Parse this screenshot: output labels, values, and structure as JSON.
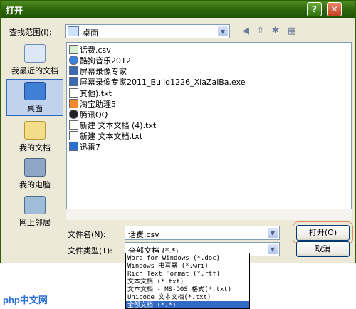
{
  "window": {
    "title": "打开",
    "help_glyph": "?",
    "close_glyph": "✕"
  },
  "lookin": {
    "label": "查找范围(I):",
    "value": "桌面"
  },
  "places": [
    {
      "label": "我最近的文档"
    },
    {
      "label": "桌面"
    },
    {
      "label": "我的文档"
    },
    {
      "label": "我的电脑"
    },
    {
      "label": "网上邻居"
    }
  ],
  "files": [
    "话费.csv",
    "酷狗音乐2012",
    "屏幕录像专家",
    "屏幕录像专家2011_Build1226_XiaZaiBa.exe",
    "其他).txt",
    "淘宝助理5",
    "腾讯QQ",
    "新建 文本文档 (4).txt",
    "新建 文本文档.txt",
    "迅雷7"
  ],
  "form": {
    "filename_label": "文件名(N):",
    "filename_value": "话费.csv",
    "filetype_label": "文件类型(T):",
    "filetype_value": "全部文档 (*.*)",
    "open_button": "打开(O)",
    "cancel_button": "取消"
  },
  "filetype_options": [
    "Word for Windows (*.doc)",
    "Windows 书写器 (*.wri)",
    "Rich Text Format (*.rtf)",
    "文本文档 (*.txt)",
    "文本文档 - MS-DOS 格式(*.txt)",
    "Unicode 文本文档(*.txt)",
    "全部文档 (*.*)"
  ],
  "watermark": "php中文网"
}
